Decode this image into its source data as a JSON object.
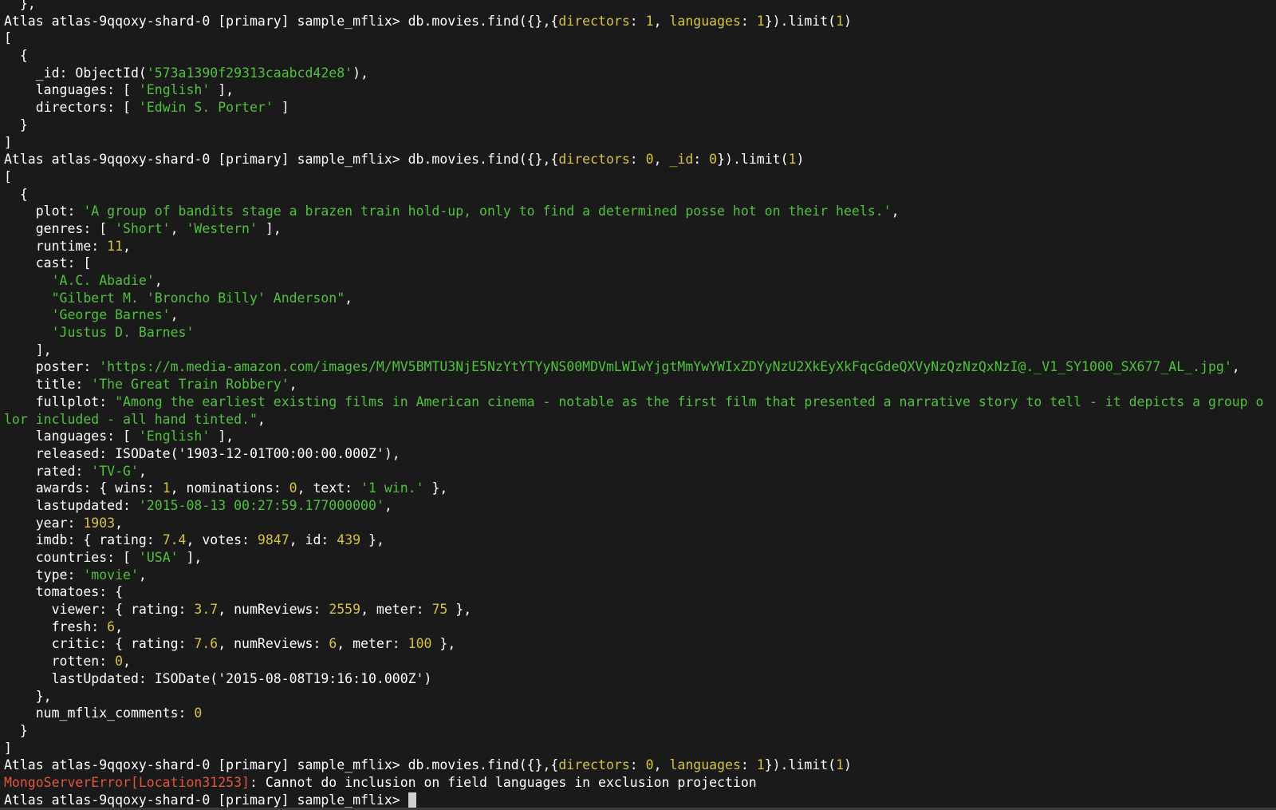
{
  "terminal": {
    "prompt": "Atlas atlas-9qqoxy-shard-0 [primary] sample_mflix> ",
    "lines": [
      [
        [
          "t",
          "  },"
        ]
      ],
      [
        [
          "t",
          "Atlas atlas-9qqoxy-shard-0 [primary] sample_mflix> db.movies.find({},{"
        ],
        [
          "k",
          "directors"
        ],
        [
          "t",
          ": "
        ],
        [
          "n",
          "1"
        ],
        [
          "t",
          ", "
        ],
        [
          "k",
          "languages"
        ],
        [
          "t",
          ": "
        ],
        [
          "n",
          "1"
        ],
        [
          "t",
          "}).limit("
        ],
        [
          "n",
          "1"
        ],
        [
          "t",
          ")"
        ]
      ],
      [
        [
          "t",
          "["
        ]
      ],
      [
        [
          "t",
          "  {"
        ]
      ],
      [
        [
          "t",
          "    _id: ObjectId("
        ],
        [
          "s",
          "'573a1390f29313caabcd42e8'"
        ],
        [
          "t",
          "),"
        ]
      ],
      [
        [
          "t",
          "    languages: [ "
        ],
        [
          "s",
          "'English'"
        ],
        [
          "t",
          " ],"
        ]
      ],
      [
        [
          "t",
          "    directors: [ "
        ],
        [
          "s",
          "'Edwin S. Porter'"
        ],
        [
          "t",
          " ]"
        ]
      ],
      [
        [
          "t",
          "  }"
        ]
      ],
      [
        [
          "t",
          "]"
        ]
      ],
      [
        [
          "t",
          "Atlas atlas-9qqoxy-shard-0 [primary] sample_mflix> db.movies.find({},{"
        ],
        [
          "k",
          "directors"
        ],
        [
          "t",
          ": "
        ],
        [
          "n",
          "0"
        ],
        [
          "t",
          ", "
        ],
        [
          "k",
          "_id"
        ],
        [
          "t",
          ": "
        ],
        [
          "n",
          "0"
        ],
        [
          "t",
          "}).limit("
        ],
        [
          "n",
          "1"
        ],
        [
          "t",
          ")"
        ]
      ],
      [
        [
          "t",
          "["
        ]
      ],
      [
        [
          "t",
          "  {"
        ]
      ],
      [
        [
          "t",
          "    plot: "
        ],
        [
          "s",
          "'A group of bandits stage a brazen train hold-up, only to find a determined posse hot on their heels.'"
        ],
        [
          "t",
          ","
        ]
      ],
      [
        [
          "t",
          "    genres: [ "
        ],
        [
          "s",
          "'Short'"
        ],
        [
          "t",
          ", "
        ],
        [
          "s",
          "'Western'"
        ],
        [
          "t",
          " ],"
        ]
      ],
      [
        [
          "t",
          "    runtime: "
        ],
        [
          "n",
          "11"
        ],
        [
          "t",
          ","
        ]
      ],
      [
        [
          "t",
          "    cast: ["
        ]
      ],
      [
        [
          "t",
          "      "
        ],
        [
          "s",
          "'A.C. Abadie'"
        ],
        [
          "t",
          ","
        ]
      ],
      [
        [
          "t",
          "      "
        ],
        [
          "s",
          "\"Gilbert M. 'Broncho Billy' Anderson\""
        ],
        [
          "t",
          ","
        ]
      ],
      [
        [
          "t",
          "      "
        ],
        [
          "s",
          "'George Barnes'"
        ],
        [
          "t",
          ","
        ]
      ],
      [
        [
          "t",
          "      "
        ],
        [
          "s",
          "'Justus D. Barnes'"
        ]
      ],
      [
        [
          "t",
          "    ],"
        ]
      ],
      [
        [
          "t",
          "    poster: "
        ],
        [
          "s",
          "'https://m.media-amazon.com/images/M/MV5BMTU3NjE5NzYtYTYyNS00MDVmLWIwYjgtMmYwYWIxZDYyNzU2XkEyXkFqcGdeQXVyNzQzNzQxNzI@._V1_SY1000_SX677_AL_.jpg'"
        ],
        [
          "t",
          ","
        ]
      ],
      [
        [
          "t",
          "    title: "
        ],
        [
          "s",
          "'The Great Train Robbery'"
        ],
        [
          "t",
          ","
        ]
      ],
      [
        [
          "t",
          "    fullplot: "
        ],
        [
          "s",
          "\"Among the earliest existing films in American cinema - notable as the first film that presented a narrative story to tell - it depicts a group o"
        ]
      ],
      [
        [
          "s",
          "lor included - all hand tinted.\""
        ],
        [
          "t",
          ","
        ]
      ],
      [
        [
          "t",
          "    languages: [ "
        ],
        [
          "s",
          "'English'"
        ],
        [
          "t",
          " ],"
        ]
      ],
      [
        [
          "t",
          "    released: ISODate('1903-12-01T00:00:00.000Z'),"
        ]
      ],
      [
        [
          "t",
          "    rated: "
        ],
        [
          "s",
          "'TV-G'"
        ],
        [
          "t",
          ","
        ]
      ],
      [
        [
          "t",
          "    awards: { wins: "
        ],
        [
          "n",
          "1"
        ],
        [
          "t",
          ", nominations: "
        ],
        [
          "n",
          "0"
        ],
        [
          "t",
          ", text: "
        ],
        [
          "s",
          "'1 win.'"
        ],
        [
          "t",
          " },"
        ]
      ],
      [
        [
          "t",
          "    lastupdated: "
        ],
        [
          "s",
          "'2015-08-13 00:27:59.177000000'"
        ],
        [
          "t",
          ","
        ]
      ],
      [
        [
          "t",
          "    year: "
        ],
        [
          "n",
          "1903"
        ],
        [
          "t",
          ","
        ]
      ],
      [
        [
          "t",
          "    imdb: { rating: "
        ],
        [
          "n",
          "7.4"
        ],
        [
          "t",
          ", votes: "
        ],
        [
          "n",
          "9847"
        ],
        [
          "t",
          ", id: "
        ],
        [
          "n",
          "439"
        ],
        [
          "t",
          " },"
        ]
      ],
      [
        [
          "t",
          "    countries: [ "
        ],
        [
          "s",
          "'USA'"
        ],
        [
          "t",
          " ],"
        ]
      ],
      [
        [
          "t",
          "    type: "
        ],
        [
          "s",
          "'movie'"
        ],
        [
          "t",
          ","
        ]
      ],
      [
        [
          "t",
          "    tomatoes: {"
        ]
      ],
      [
        [
          "t",
          "      viewer: { rating: "
        ],
        [
          "n",
          "3.7"
        ],
        [
          "t",
          ", numReviews: "
        ],
        [
          "n",
          "2559"
        ],
        [
          "t",
          ", meter: "
        ],
        [
          "n",
          "75"
        ],
        [
          "t",
          " },"
        ]
      ],
      [
        [
          "t",
          "      fresh: "
        ],
        [
          "n",
          "6"
        ],
        [
          "t",
          ","
        ]
      ],
      [
        [
          "t",
          "      critic: { rating: "
        ],
        [
          "n",
          "7.6"
        ],
        [
          "t",
          ", numReviews: "
        ],
        [
          "n",
          "6"
        ],
        [
          "t",
          ", meter: "
        ],
        [
          "n",
          "100"
        ],
        [
          "t",
          " },"
        ]
      ],
      [
        [
          "t",
          "      rotten: "
        ],
        [
          "n",
          "0"
        ],
        [
          "t",
          ","
        ]
      ],
      [
        [
          "t",
          "      lastUpdated: ISODate('2015-08-08T19:16:10.000Z')"
        ]
      ],
      [
        [
          "t",
          "    },"
        ]
      ],
      [
        [
          "t",
          "    num_mflix_comments: "
        ],
        [
          "n",
          "0"
        ]
      ],
      [
        [
          "t",
          "  }"
        ]
      ],
      [
        [
          "t",
          "]"
        ]
      ],
      [
        [
          "t",
          "Atlas atlas-9qqoxy-shard-0 [primary] sample_mflix> db.movies.find({},{"
        ],
        [
          "k",
          "directors"
        ],
        [
          "t",
          ": "
        ],
        [
          "n",
          "0"
        ],
        [
          "t",
          ", "
        ],
        [
          "k",
          "languages"
        ],
        [
          "t",
          ": "
        ],
        [
          "n",
          "1"
        ],
        [
          "t",
          "}).limit("
        ],
        [
          "n",
          "1"
        ],
        [
          "t",
          ")"
        ]
      ],
      [
        [
          "e",
          "MongoServerError[Location31253]"
        ],
        [
          "t",
          ": Cannot do inclusion on field languages in exclusion projection"
        ]
      ],
      [
        [
          "t",
          "Atlas atlas-9qqoxy-shard-0 [primary] sample_mflix> "
        ],
        [
          "c",
          ""
        ]
      ]
    ]
  }
}
